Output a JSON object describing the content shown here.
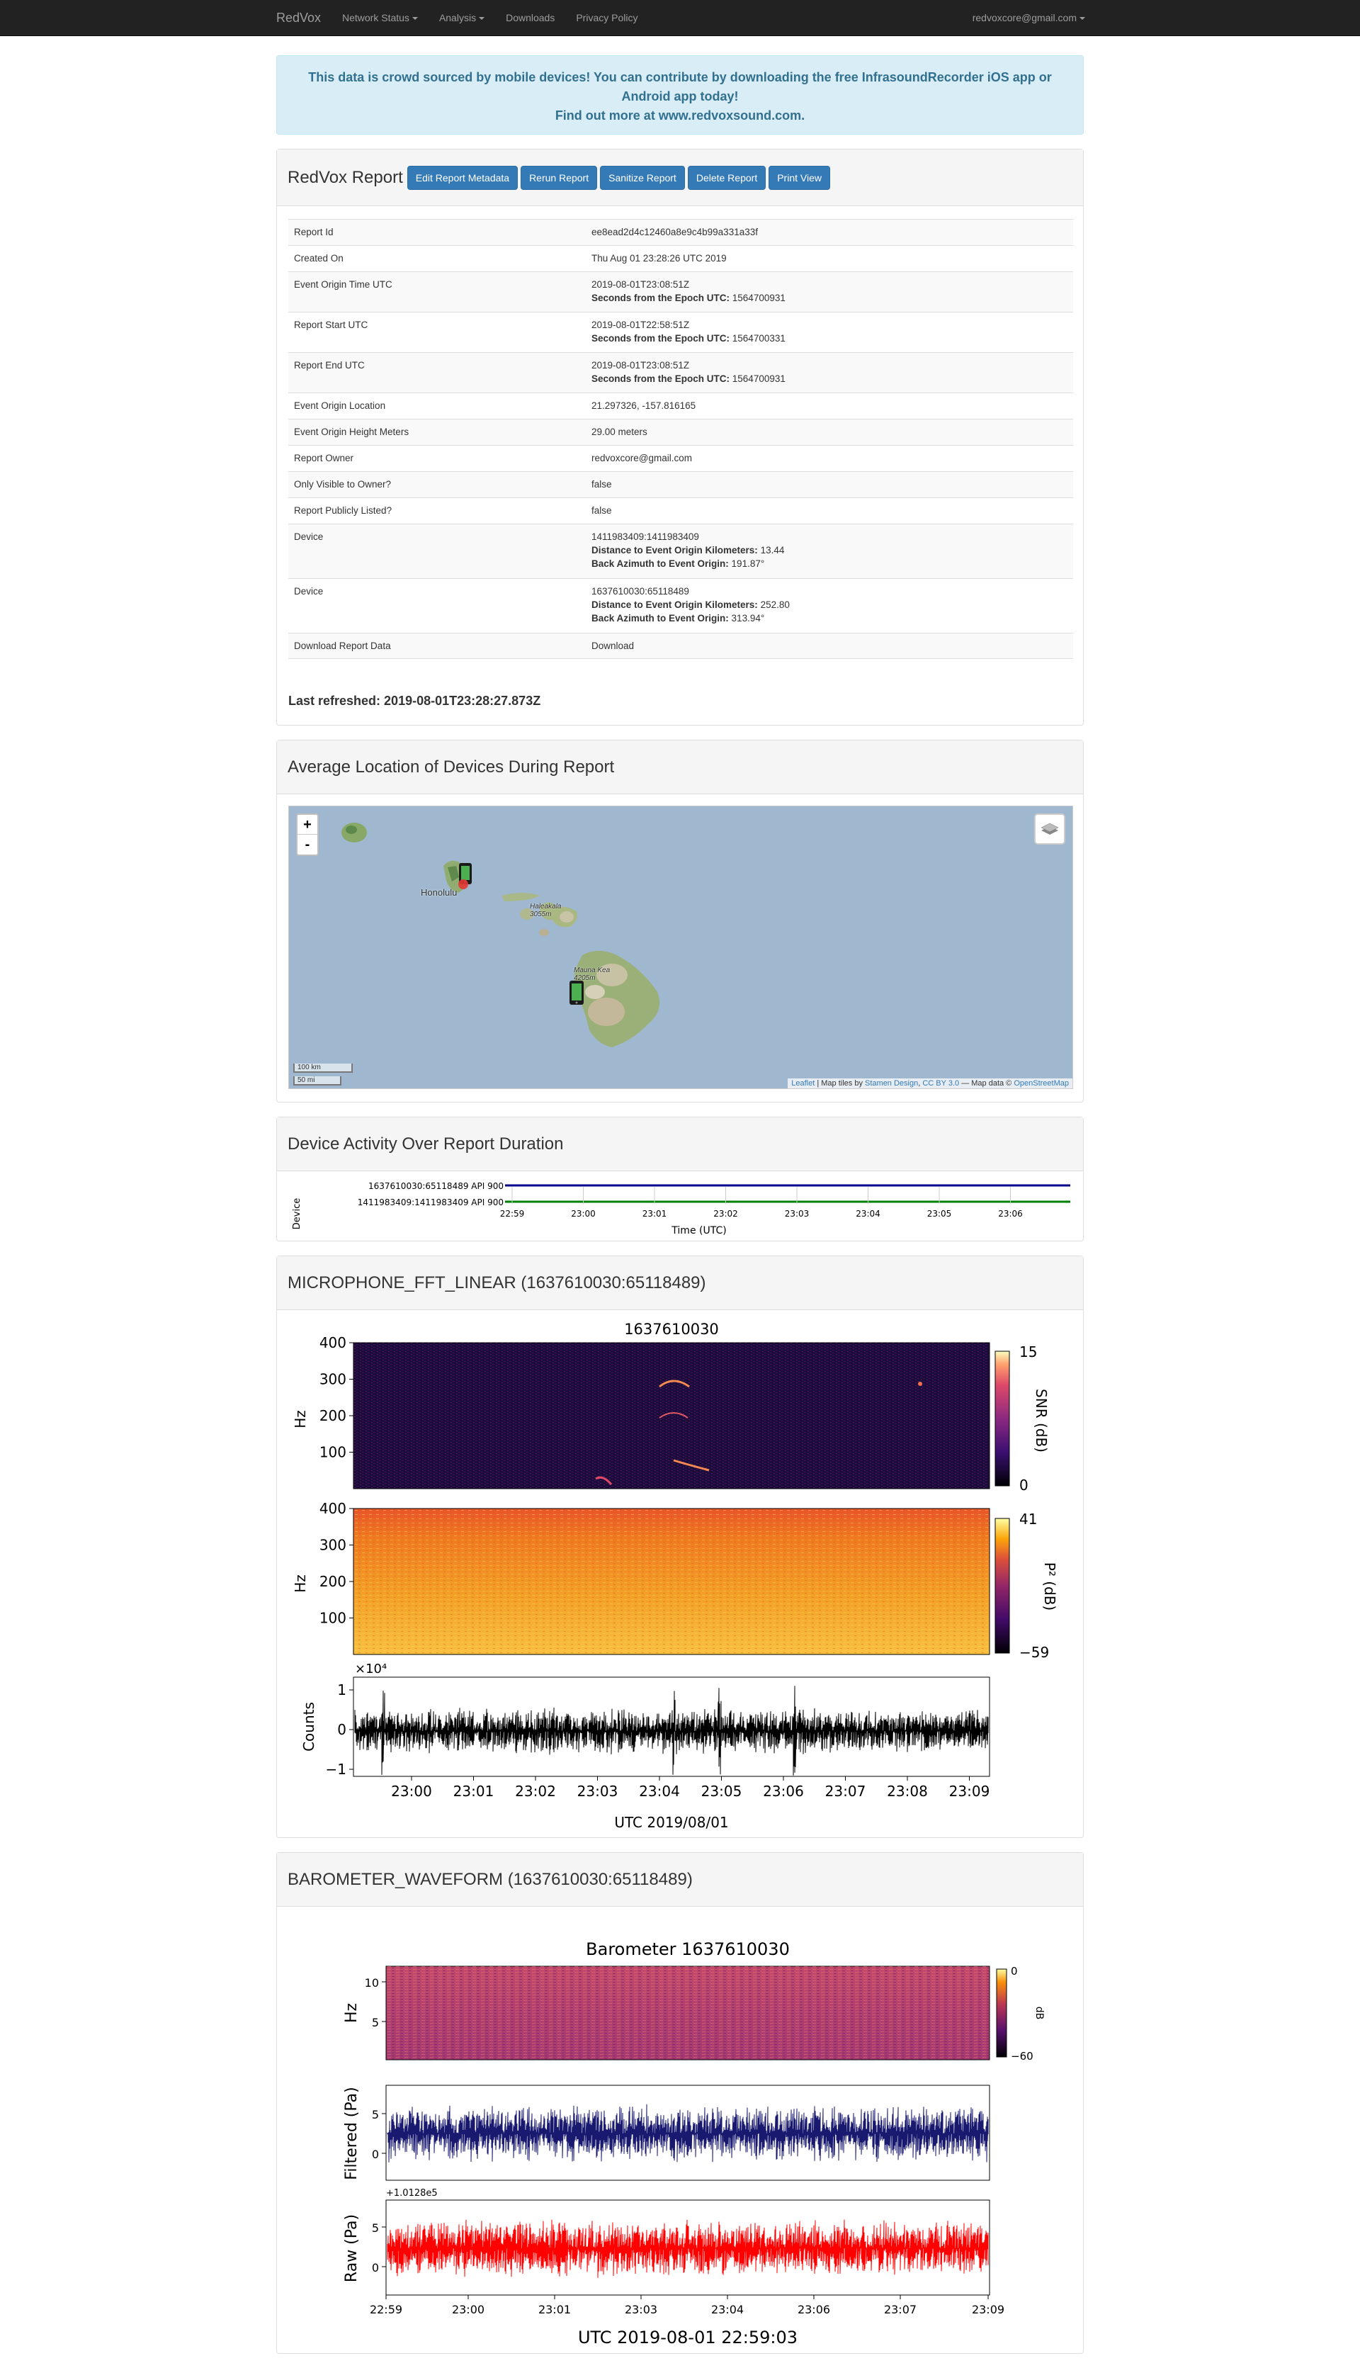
{
  "navbar": {
    "brand": "RedVox",
    "items": [
      "Network Status",
      "Analysis",
      "Downloads",
      "Privacy Policy"
    ],
    "user": "redvoxcore@gmail.com"
  },
  "alert": {
    "line1": "This data is crowd sourced by mobile devices! You can contribute by downloading the free InfrasoundRecorder iOS app or",
    "line2": "Android app today!",
    "line3": "Find out more at www.redvoxsound.com."
  },
  "report": {
    "title": "RedVox Report",
    "buttons": [
      "Edit Report Metadata",
      "Rerun Report",
      "Sanitize Report",
      "Delete Report",
      "Print View"
    ],
    "epoch_label": "Seconds from the Epoch UTC:",
    "distance_label": "Distance to Event Origin Kilometers:",
    "azimuth_label": "Back Azimuth to Event Origin:",
    "rows": {
      "report_id": {
        "key": "Report Id",
        "value": "ee8ead2d4c12460a8e9c4b99a331a33f"
      },
      "created_on": {
        "key": "Created On",
        "value": "Thu Aug 01 23:28:26 UTC 2019"
      },
      "event_origin_time": {
        "key": "Event Origin Time UTC",
        "value": "2019-08-01T23:08:51Z",
        "epoch": "1564700931"
      },
      "report_start": {
        "key": "Report Start UTC",
        "value": "2019-08-01T22:58:51Z",
        "epoch": "1564700331"
      },
      "report_end": {
        "key": "Report End UTC",
        "value": "2019-08-01T23:08:51Z",
        "epoch": "1564700931"
      },
      "event_origin_location": {
        "key": "Event Origin Location",
        "value": "21.297326, -157.816165"
      },
      "event_origin_height": {
        "key": "Event Origin Height Meters",
        "value": "29.00 meters"
      },
      "report_owner": {
        "key": "Report Owner",
        "value": "redvoxcore@gmail.com"
      },
      "only_visible": {
        "key": "Only Visible to Owner?",
        "value": "false"
      },
      "publicly_listed": {
        "key": "Report Publicly Listed?",
        "value": "false"
      },
      "device1": {
        "key": "Device",
        "value": "1411983409:1411983409",
        "distance": "13.44",
        "azimuth": "191.87°"
      },
      "device2": {
        "key": "Device",
        "value": "1637610030:65118489",
        "distance": "252.80",
        "azimuth": "313.94°"
      },
      "download": {
        "key": "Download Report Data",
        "value": "Download"
      }
    },
    "last_refreshed": "Last refreshed: 2019-08-01T23:28:27.873Z"
  },
  "map_panel": {
    "title": "Average Location of Devices During Report",
    "zoom_in": "+",
    "zoom_out": "-",
    "labels": {
      "honolulu": "Honolulu",
      "haleakala": "Haleakala\n3055m",
      "mauna_kea": "Mauna Kea\n4205m"
    },
    "scale_km": "100 km",
    "scale_mi": "50 mi",
    "attribution": {
      "leaflet": "Leaflet",
      "text": " | Map tiles by ",
      "stamen": "Stamen Design",
      "cc": "CC BY 3.0",
      "osm_prefix": " — Map data © ",
      "osm": "OpenStreetMap"
    }
  },
  "activity_panel": {
    "title": "Device Activity Over Report Duration",
    "ylabel": "Device",
    "xlabel": "Time (UTC)",
    "devices": [
      "1637610030:65118489 API 900",
      "1411983409:1411983409 API 900"
    ],
    "colors": [
      "#00008b",
      "#008000"
    ],
    "ticks": [
      "22:59",
      "23:00",
      "23:01",
      "23:02",
      "23:03",
      "23:04",
      "23:05",
      "23:06"
    ]
  },
  "fft_panel": {
    "title": "MICROPHONE_FFT_LINEAR (1637610030:65118489)",
    "plot_title": "1637610030",
    "hz_label": "Hz",
    "y_ticks": [
      "400",
      "300",
      "200",
      "100"
    ],
    "snr_label": "SNR (dB)",
    "snr_ticks": [
      "15",
      "0"
    ],
    "psd_label": "P² (dB)",
    "psd_ticks": [
      "41",
      "−59"
    ],
    "counts_label": "Counts",
    "counts_exp": "×10⁴",
    "counts_ticks": [
      "1",
      "0",
      "−1"
    ],
    "x_ticks": [
      "23:00",
      "23:01",
      "23:02",
      "23:03",
      "23:04",
      "23:05",
      "23:06",
      "23:07",
      "23:08",
      "23:09"
    ],
    "xlabel": "UTC 2019/08/01"
  },
  "baro_panel": {
    "title": "BAROMETER_WAVEFORM (1637610030:65118489)",
    "plot_title": "Barometer 1637610030",
    "hz_label": "Hz",
    "hz_ticks": [
      "10",
      "5"
    ],
    "db_label": "dB",
    "db_ticks": [
      "0",
      "−60"
    ],
    "filtered_label": "Filtered (Pa)",
    "filtered_ticks": [
      "5",
      "0"
    ],
    "raw_label": "Raw (Pa)",
    "raw_offset": "+1.0128e5",
    "raw_ticks": [
      "5",
      "0"
    ],
    "x_ticks": [
      "22:59",
      "23:00",
      "23:01",
      "23:03",
      "23:04",
      "23:06",
      "23:07",
      "23:09"
    ],
    "xlabel": "UTC 2019-08-01 22:59:03"
  }
}
